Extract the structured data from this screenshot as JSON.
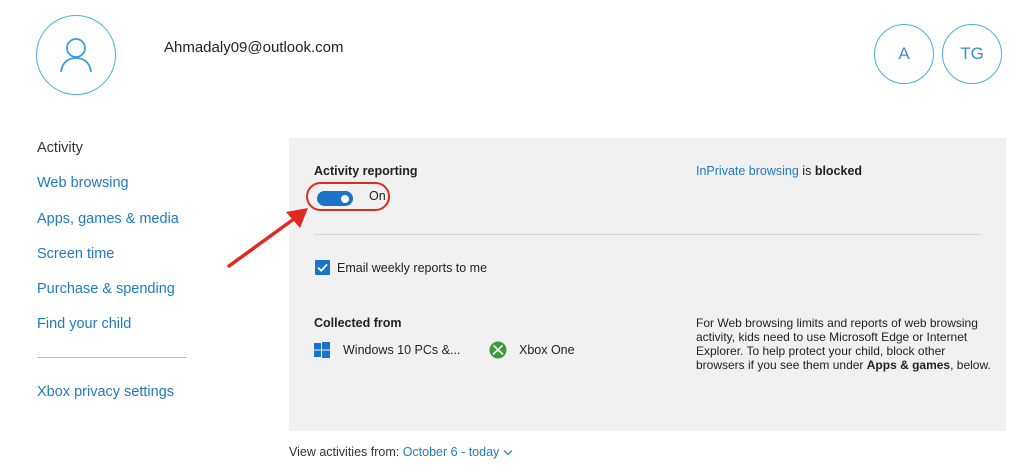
{
  "header": {
    "email": "Ahmadaly09@outlook.com",
    "members": [
      "A",
      "TG"
    ]
  },
  "nav": {
    "items": [
      {
        "label": "Activity"
      },
      {
        "label": "Web browsing"
      },
      {
        "label": "Apps, games & media"
      },
      {
        "label": "Screen time"
      },
      {
        "label": "Purchase & spending"
      },
      {
        "label": "Find your child"
      }
    ],
    "xbox_privacy": "Xbox privacy settings"
  },
  "activity": {
    "reporting_label": "Activity reporting",
    "toggle_state": "On",
    "inprivate_link": "InPrivate browsing",
    "inprivate_is": " is ",
    "inprivate_status": "blocked",
    "email_reports_label": "Email weekly reports to me",
    "collected_from_label": "Collected from",
    "sources": [
      "Windows 10 PCs &...",
      "Xbox One"
    ],
    "info_part1": "For Web browsing limits and reports of web browsing activity, kids need to use Microsoft Edge or Internet Explorer. To help protect your child, block other browsers if you see them under ",
    "info_bold": "Apps & games",
    "info_part2": ", below."
  },
  "footer": {
    "view_label": "View activities from: ",
    "date_range": "October 6 - today"
  },
  "colors": {
    "accent": "#1f7ac2",
    "toggle_on": "#1a73c8",
    "highlight": "#e02a1f",
    "panel_bg": "#f1f1f1",
    "avatar_border": "#4ab0e0"
  },
  "icons": [
    "user-icon",
    "windows-icon",
    "xbox-icon",
    "checkmark-icon",
    "chevron-down-icon",
    "annotation-arrow-icon"
  ]
}
